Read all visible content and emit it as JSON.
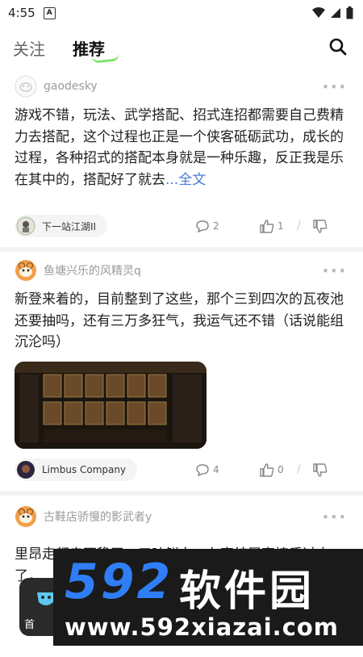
{
  "status": {
    "time": "4:55"
  },
  "header": {
    "tabs": [
      {
        "label": "关注"
      },
      {
        "label": "推荐"
      }
    ]
  },
  "posts": [
    {
      "author": "gaodesky",
      "text": "游戏不错，玩法、武学搭配、招式连招都需要自己费精力去搭配，这个过程也正是一个侠客砥砺武功，成长的过程，各种招式的搭配本身就是一种乐趣，反正我是乐在其中的，搭配好了就去",
      "more_link": "...全文",
      "topic": "下一站江湖II",
      "comments": "2",
      "likes": "1"
    },
    {
      "author": "鱼塘兴乐的风精灵q",
      "text": "新登来着的，目前整到了这些，那个三到四次的瓦夜池还要抽吗，还有三万多狂气，我运气还不错（话说能组沉沦吗）",
      "topic": "Limbus Company",
      "comments": "4",
      "likes": "0"
    },
    {
      "author": "古鞋店骄慢的影武者y",
      "text": "里昂走都走不稳了，口吐鲜血，在直结层直接质过去了，"
    }
  ],
  "bottom": {
    "home_label": "首"
  },
  "watermark": {
    "brand": "592",
    "brand_cn": "软件园",
    "url": "www.592xiazai.com"
  }
}
